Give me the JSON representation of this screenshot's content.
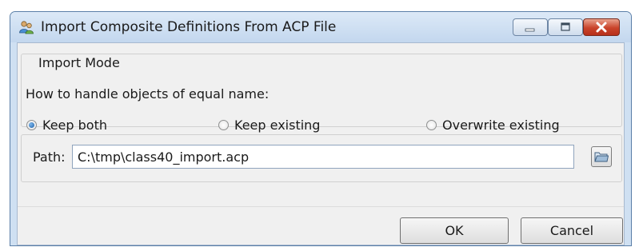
{
  "window": {
    "title": "Import Composite Definitions From ACP File",
    "icon": "people-icon",
    "controls": {
      "minimize": "minimize-icon",
      "maximize": "maximize-icon",
      "close": "close-icon"
    }
  },
  "import_mode": {
    "legend": "Import Mode",
    "question": "How to handle objects of equal name:",
    "options": [
      {
        "label": "Keep both",
        "checked": true
      },
      {
        "label": "Keep existing",
        "checked": false
      },
      {
        "label": "Overwrite existing",
        "checked": false
      }
    ]
  },
  "path": {
    "label": "Path:",
    "value": "C:\\tmp\\class40_import.acp",
    "browse_icon": "folder-icon"
  },
  "buttons": {
    "ok": "OK",
    "cancel": "Cancel"
  },
  "colors": {
    "title_bar": "#c3d7ee",
    "close_button": "#c9432a",
    "client_bg": "#f0f0f0",
    "radio_checked": "#1d5fa8"
  }
}
